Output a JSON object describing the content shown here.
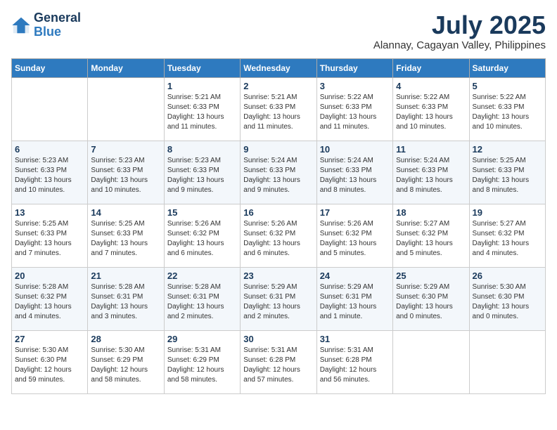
{
  "logo": {
    "general": "General",
    "blue": "Blue"
  },
  "title": "July 2025",
  "subtitle": "Alannay, Cagayan Valley, Philippines",
  "weekdays": [
    "Sunday",
    "Monday",
    "Tuesday",
    "Wednesday",
    "Thursday",
    "Friday",
    "Saturday"
  ],
  "weeks": [
    [
      {
        "num": "",
        "detail": ""
      },
      {
        "num": "",
        "detail": ""
      },
      {
        "num": "1",
        "detail": "Sunrise: 5:21 AM\nSunset: 6:33 PM\nDaylight: 13 hours and 11 minutes."
      },
      {
        "num": "2",
        "detail": "Sunrise: 5:21 AM\nSunset: 6:33 PM\nDaylight: 13 hours and 11 minutes."
      },
      {
        "num": "3",
        "detail": "Sunrise: 5:22 AM\nSunset: 6:33 PM\nDaylight: 13 hours and 11 minutes."
      },
      {
        "num": "4",
        "detail": "Sunrise: 5:22 AM\nSunset: 6:33 PM\nDaylight: 13 hours and 10 minutes."
      },
      {
        "num": "5",
        "detail": "Sunrise: 5:22 AM\nSunset: 6:33 PM\nDaylight: 13 hours and 10 minutes."
      }
    ],
    [
      {
        "num": "6",
        "detail": "Sunrise: 5:23 AM\nSunset: 6:33 PM\nDaylight: 13 hours and 10 minutes."
      },
      {
        "num": "7",
        "detail": "Sunrise: 5:23 AM\nSunset: 6:33 PM\nDaylight: 13 hours and 10 minutes."
      },
      {
        "num": "8",
        "detail": "Sunrise: 5:23 AM\nSunset: 6:33 PM\nDaylight: 13 hours and 9 minutes."
      },
      {
        "num": "9",
        "detail": "Sunrise: 5:24 AM\nSunset: 6:33 PM\nDaylight: 13 hours and 9 minutes."
      },
      {
        "num": "10",
        "detail": "Sunrise: 5:24 AM\nSunset: 6:33 PM\nDaylight: 13 hours and 8 minutes."
      },
      {
        "num": "11",
        "detail": "Sunrise: 5:24 AM\nSunset: 6:33 PM\nDaylight: 13 hours and 8 minutes."
      },
      {
        "num": "12",
        "detail": "Sunrise: 5:25 AM\nSunset: 6:33 PM\nDaylight: 13 hours and 8 minutes."
      }
    ],
    [
      {
        "num": "13",
        "detail": "Sunrise: 5:25 AM\nSunset: 6:33 PM\nDaylight: 13 hours and 7 minutes."
      },
      {
        "num": "14",
        "detail": "Sunrise: 5:25 AM\nSunset: 6:33 PM\nDaylight: 13 hours and 7 minutes."
      },
      {
        "num": "15",
        "detail": "Sunrise: 5:26 AM\nSunset: 6:32 PM\nDaylight: 13 hours and 6 minutes."
      },
      {
        "num": "16",
        "detail": "Sunrise: 5:26 AM\nSunset: 6:32 PM\nDaylight: 13 hours and 6 minutes."
      },
      {
        "num": "17",
        "detail": "Sunrise: 5:26 AM\nSunset: 6:32 PM\nDaylight: 13 hours and 5 minutes."
      },
      {
        "num": "18",
        "detail": "Sunrise: 5:27 AM\nSunset: 6:32 PM\nDaylight: 13 hours and 5 minutes."
      },
      {
        "num": "19",
        "detail": "Sunrise: 5:27 AM\nSunset: 6:32 PM\nDaylight: 13 hours and 4 minutes."
      }
    ],
    [
      {
        "num": "20",
        "detail": "Sunrise: 5:28 AM\nSunset: 6:32 PM\nDaylight: 13 hours and 4 minutes."
      },
      {
        "num": "21",
        "detail": "Sunrise: 5:28 AM\nSunset: 6:31 PM\nDaylight: 13 hours and 3 minutes."
      },
      {
        "num": "22",
        "detail": "Sunrise: 5:28 AM\nSunset: 6:31 PM\nDaylight: 13 hours and 2 minutes."
      },
      {
        "num": "23",
        "detail": "Sunrise: 5:29 AM\nSunset: 6:31 PM\nDaylight: 13 hours and 2 minutes."
      },
      {
        "num": "24",
        "detail": "Sunrise: 5:29 AM\nSunset: 6:31 PM\nDaylight: 13 hours and 1 minute."
      },
      {
        "num": "25",
        "detail": "Sunrise: 5:29 AM\nSunset: 6:30 PM\nDaylight: 13 hours and 0 minutes."
      },
      {
        "num": "26",
        "detail": "Sunrise: 5:30 AM\nSunset: 6:30 PM\nDaylight: 13 hours and 0 minutes."
      }
    ],
    [
      {
        "num": "27",
        "detail": "Sunrise: 5:30 AM\nSunset: 6:30 PM\nDaylight: 12 hours and 59 minutes."
      },
      {
        "num": "28",
        "detail": "Sunrise: 5:30 AM\nSunset: 6:29 PM\nDaylight: 12 hours and 58 minutes."
      },
      {
        "num": "29",
        "detail": "Sunrise: 5:31 AM\nSunset: 6:29 PM\nDaylight: 12 hours and 58 minutes."
      },
      {
        "num": "30",
        "detail": "Sunrise: 5:31 AM\nSunset: 6:28 PM\nDaylight: 12 hours and 57 minutes."
      },
      {
        "num": "31",
        "detail": "Sunrise: 5:31 AM\nSunset: 6:28 PM\nDaylight: 12 hours and 56 minutes."
      },
      {
        "num": "",
        "detail": ""
      },
      {
        "num": "",
        "detail": ""
      }
    ]
  ]
}
